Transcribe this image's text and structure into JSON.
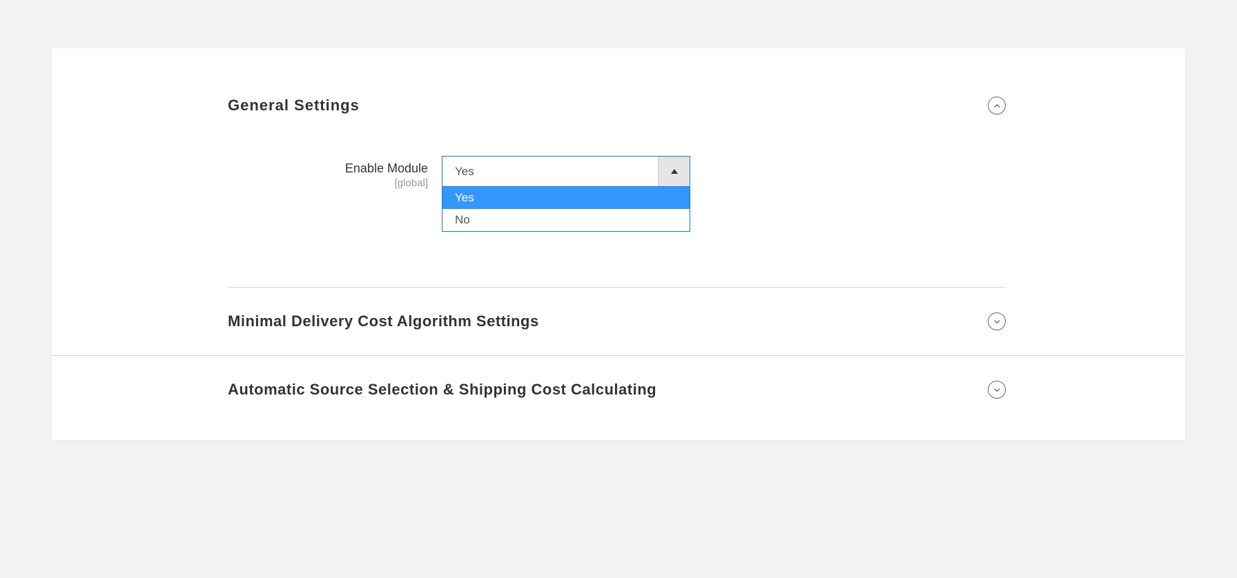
{
  "sections": {
    "general": {
      "title": "General Settings",
      "expanded": true,
      "fields": {
        "enable_module": {
          "label": "Enable Module",
          "scope": "[global]",
          "value": "Yes",
          "options": [
            "Yes",
            "No"
          ]
        }
      }
    },
    "minimal_delivery": {
      "title": "Minimal Delivery Cost Algorithm Settings",
      "expanded": false
    },
    "auto_source": {
      "title": "Automatic Source Selection & Shipping Cost Calculating",
      "expanded": false
    }
  }
}
